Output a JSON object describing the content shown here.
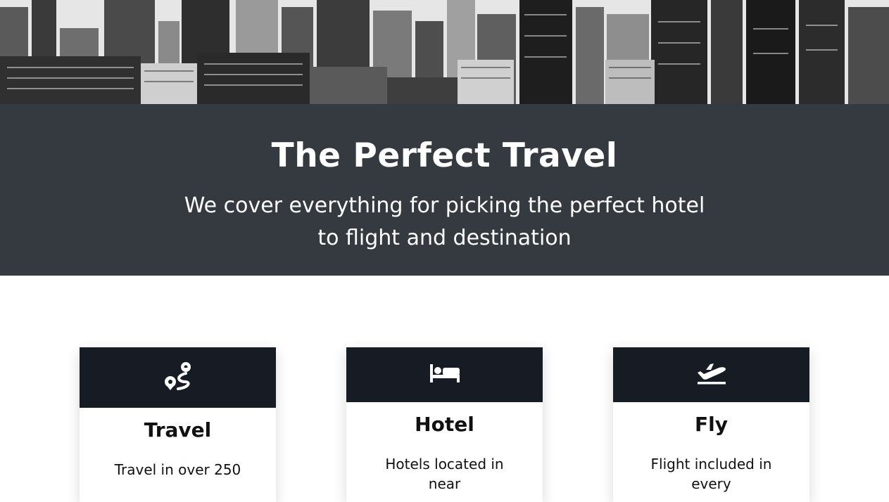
{
  "hero": {
    "alt": "city skyline"
  },
  "headline": {
    "title": "The Perfect Travel",
    "subtitle_line1": "We cover everything for picking the perfect hotel",
    "subtitle_line2": "to flight and destination"
  },
  "cards": [
    {
      "icon": "route-icon",
      "title": "Travel",
      "text": "Travel in over 250"
    },
    {
      "icon": "bed-icon",
      "title": "Hotel",
      "text": "Hotels located in near"
    },
    {
      "icon": "plane-departure-icon",
      "title": "Fly",
      "text": "Flight included in every"
    }
  ],
  "colors": {
    "band": "#343a40",
    "card_header": "#171c24",
    "text_light": "#ffffff",
    "text_dark": "#111111"
  }
}
